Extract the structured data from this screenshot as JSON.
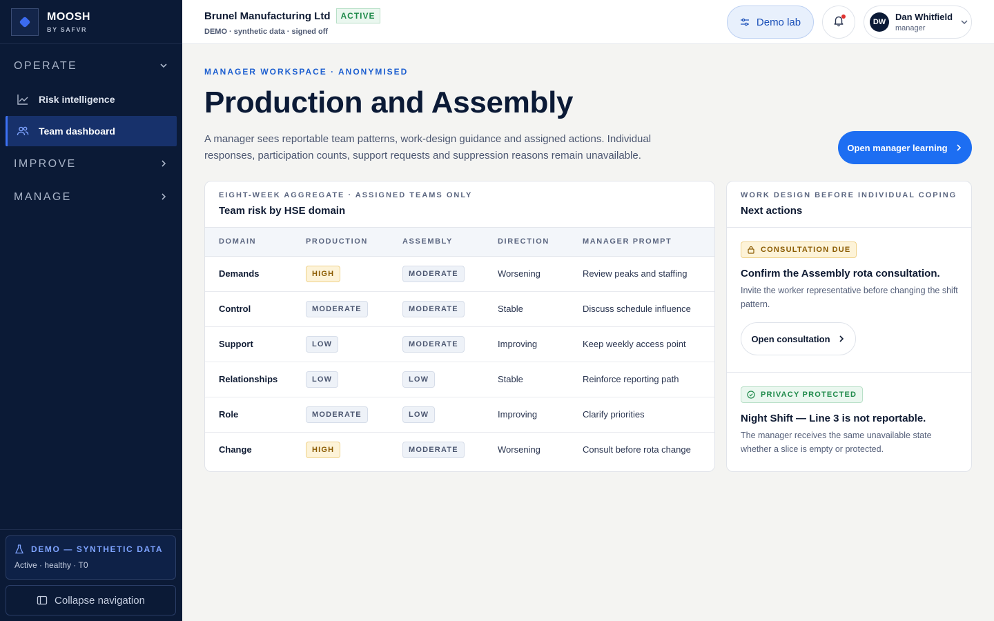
{
  "brand": {
    "name": "MOOSH",
    "sub": "BY SAFVR"
  },
  "sidebar": {
    "sections": [
      {
        "label": "OPERATE",
        "chevron": "chevron-down-icon"
      },
      {
        "label": "IMPROVE",
        "chevron": "chevron-right-icon"
      },
      {
        "label": "MANAGE",
        "chevron": "chevron-right-icon"
      }
    ],
    "items": [
      {
        "label": "Risk intelligence",
        "icon": "chart-line-icon"
      },
      {
        "label": "Team dashboard",
        "icon": "users-icon",
        "active": true
      }
    ],
    "demo": {
      "title": "DEMO — SYNTHETIC DATA",
      "sub": "Active · healthy · T0"
    },
    "collapse_label": "Collapse navigation"
  },
  "header": {
    "org_name": "Brunel Manufacturing Ltd",
    "org_status": "ACTIVE",
    "org_meta": "DEMO · synthetic data · signed off",
    "demo_lab_label": "Demo lab",
    "user": {
      "initials": "DW",
      "name": "Dan Whitfield",
      "role": "manager"
    }
  },
  "main": {
    "eyebrow": "MANAGER WORKSPACE · ANONYMISED",
    "title": "Production and Assembly",
    "description": "A manager sees reportable team patterns, work-design guidance and assigned actions. Individual responses, participation counts, support requests and suppression reasons remain unavailable.",
    "learn_button": "Open manager learning"
  },
  "risk_card": {
    "eyebrow": "EIGHT-WEEK AGGREGATE · ASSIGNED TEAMS ONLY",
    "title": "Team risk by HSE domain",
    "columns": [
      "DOMAIN",
      "PRODUCTION",
      "ASSEMBLY",
      "DIRECTION",
      "MANAGER PROMPT"
    ],
    "rows": [
      {
        "domain": "Demands",
        "production": "HIGH",
        "assembly": "MODERATE",
        "direction": "Worsening",
        "prompt": "Review peaks and staffing"
      },
      {
        "domain": "Control",
        "production": "MODERATE",
        "assembly": "MODERATE",
        "direction": "Stable",
        "prompt": "Discuss schedule influence"
      },
      {
        "domain": "Support",
        "production": "LOW",
        "assembly": "MODERATE",
        "direction": "Improving",
        "prompt": "Keep weekly access point"
      },
      {
        "domain": "Relationships",
        "production": "LOW",
        "assembly": "LOW",
        "direction": "Stable",
        "prompt": "Reinforce reporting path"
      },
      {
        "domain": "Role",
        "production": "MODERATE",
        "assembly": "LOW",
        "direction": "Improving",
        "prompt": "Clarify priorities"
      },
      {
        "domain": "Change",
        "production": "HIGH",
        "assembly": "MODERATE",
        "direction": "Worsening",
        "prompt": "Consult before rota change"
      }
    ]
  },
  "actions_card": {
    "eyebrow": "WORK DESIGN BEFORE INDIVIDUAL COPING",
    "title": "Next actions",
    "items": [
      {
        "chip": "CONSULTATION DUE",
        "title": "Confirm the Assembly rota consultation.",
        "desc": "Invite the worker representative before changing the shift pattern.",
        "button": "Open consultation"
      },
      {
        "chip": "PRIVACY PROTECTED",
        "title": "Night Shift — Line 3 is not reportable.",
        "desc": "The manager receives the same unavailable state whether a slice is empty or protected."
      }
    ]
  },
  "colors": {
    "sidebar": "#0b1a36",
    "accent": "#1d6ef2",
    "active_nav": "#17316b",
    "high": "#fdf3d8",
    "success": "#1e8a4a"
  }
}
